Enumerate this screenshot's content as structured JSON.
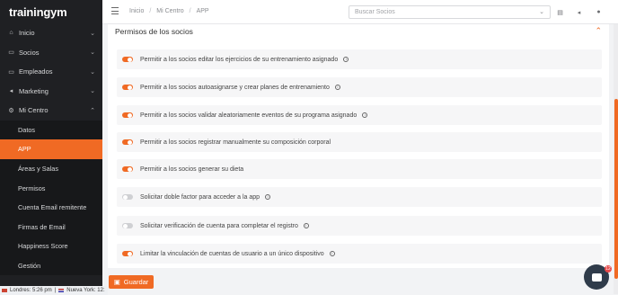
{
  "brand": {
    "logo_text": "trainingym",
    "accent": "#f06a24"
  },
  "sidebar": {
    "items": [
      {
        "label": "Inicio",
        "icon": "home-icon"
      },
      {
        "label": "Socios",
        "icon": "folder-icon"
      },
      {
        "label": "Empleados",
        "icon": "folder-icon"
      },
      {
        "label": "Marketing",
        "icon": "megaphone-icon"
      },
      {
        "label": "Mi Centro",
        "icon": "gear-icon"
      }
    ],
    "sub_items": [
      "Datos",
      "APP",
      "Áreas y Salas",
      "Permisos",
      "Cuenta Email remitente",
      "Firmas de Email",
      "Happiness Score",
      "Gestión"
    ],
    "active_sub": "APP"
  },
  "header": {
    "breadcrumbs": [
      "Inicio",
      "Mi Centro",
      "APP"
    ],
    "search_placeholder": "Buscar Socios"
  },
  "section": {
    "title": "Permisos de los socios",
    "permissions": [
      {
        "label": "Permitir a los socios editar los ejercicios de su entrenamiento asignado",
        "enabled": true
      },
      {
        "label": "Permitir a los socios autoasignarse y crear planes de entrenamiento",
        "enabled": true
      },
      {
        "label": "Permitir a los socios validar aleatoriamente eventos de su programa asignado",
        "enabled": true
      },
      {
        "label": "Permitir a los socios registrar manualmente su composición corporal",
        "enabled": true
      },
      {
        "label": "Permitir a los socios generar su dieta",
        "enabled": true
      },
      {
        "label": "Solicitar doble factor para acceder a la app",
        "enabled": false
      },
      {
        "label": "Solicitar verificación de cuenta para completar el registro",
        "enabled": false
      },
      {
        "label": "Limitar la vinculación de cuentas de usuario a un único dispositivo",
        "enabled": true
      }
    ]
  },
  "footer": {
    "save_label": "Guardar"
  },
  "chat": {
    "badge_count": "12"
  },
  "clock": {
    "london": "Londres: 5:26 pm",
    "newyork": "Nueva York: 12:"
  }
}
